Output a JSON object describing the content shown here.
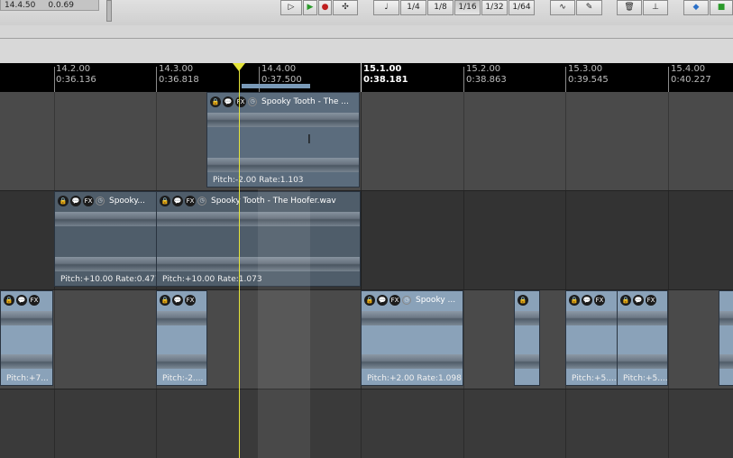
{
  "toolbar": {
    "status": [
      "14.4.50",
      "0.0.69"
    ],
    "grid_values": [
      "1/4",
      "1/8",
      "1/16",
      "1/32",
      "1/64"
    ],
    "active_grid": "1/16",
    "icons": [
      "play-icon",
      "play-green-icon",
      "record-icon",
      "run-icon",
      "note-icon",
      "waveform-icon",
      "edit-icon",
      "trash-icon",
      "split-icon",
      "diamond-icon",
      "lock-green-icon"
    ]
  },
  "ruler": {
    "marks": [
      {
        "beat": "14.2.00",
        "time": "0:36.136",
        "major": false
      },
      {
        "beat": "14.3.00",
        "time": "0:36.818",
        "major": false
      },
      {
        "beat": "14.4.00",
        "time": "0:37.500",
        "major": false
      },
      {
        "beat": "15.1.00",
        "time": "0:38.181",
        "major": true
      },
      {
        "beat": "15.2.00",
        "time": "0:38.863",
        "major": false
      },
      {
        "beat": "15.3.00",
        "time": "0:39.545",
        "major": false
      },
      {
        "beat": "15.4.00",
        "time": "0:40.227",
        "major": false
      }
    ]
  },
  "tracks": [
    {
      "items": [
        {
          "name": "Spooky Tooth - The ...",
          "pitch": "Pitch:-2.00 Rate:1.103",
          "fx": true
        }
      ]
    },
    {
      "items": [
        {
          "name": "Spooky...",
          "pitch": "Pitch:+10.00 Rate:0.477",
          "fx": true
        },
        {
          "name": "Spooky Tooth - The Hoofer.wav",
          "pitch": "Pitch:+10.00 Rate:1.073",
          "fx": true
        }
      ]
    },
    {
      "items": [
        {
          "name": "",
          "pitch": "Pitch:+7...",
          "fx": true
        },
        {
          "name": "",
          "pitch": "Pitch:-2....",
          "fx": true
        },
        {
          "name": "Spooky ...",
          "pitch": "Pitch:+2.00 Rate:1.098",
          "fx": true
        },
        {
          "name": "",
          "pitch": "",
          "fx": false
        },
        {
          "name": "",
          "pitch": "Pitch:+5....",
          "fx": true
        },
        {
          "name": "",
          "pitch": "Pitch:+5....",
          "fx": true
        }
      ]
    }
  ],
  "colors": {
    "cursor": "#e4e43a",
    "item_fill": "#5a6878",
    "item_light": "#8fa6bd"
  }
}
